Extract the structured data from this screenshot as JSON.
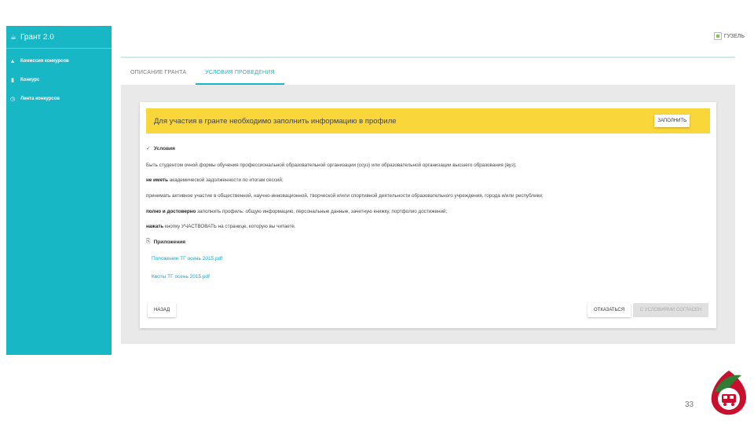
{
  "app": {
    "title": "Грант 2.0"
  },
  "sidebar": {
    "items": [
      {
        "icon": "person-icon",
        "label": "Комиссия конкурсов"
      },
      {
        "icon": "document-icon",
        "label": "Конкурс"
      },
      {
        "icon": "clock-icon",
        "label": "Лента конкурсов"
      }
    ]
  },
  "header": {
    "user_name": "ГУЗЕЛЬ"
  },
  "tabs": [
    {
      "label": "ОПИСАНИЕ ГРАНТА",
      "active": false
    },
    {
      "label": "УСЛОВИЯ ПРОВЕДЕНИЯ",
      "active": true
    }
  ],
  "banner": {
    "text": "Для участия в гранте необходимо заполнить информацию в профиле",
    "button": "ЗАПОЛНИТЬ"
  },
  "conditions": {
    "title": "Условия",
    "items": [
      {
        "bold": "",
        "text": "Быть студентом очной формы обучения профессиональной образовательной организации (ссуз) или образовательной организации высшего образования (вуз);"
      },
      {
        "bold": "не иметь",
        "text": " академической задолженности по итогам сессий;"
      },
      {
        "bold": "",
        "text": "принимать активное участие в общественной, научно-инновационной, творческой и/или спортивной деятельности образовательного учреждения, города и/или республики;"
      },
      {
        "bold": "полно и достоверно",
        "text": " заполнить профиль: общую информацию, персональные данные, зачетную книжку, портфолио достижений;"
      },
      {
        "bold": "нажать",
        "text": " кнопку УЧАСТВОВАТЬ на странице, которую вы читаете."
      }
    ]
  },
  "attachments": {
    "title": "Приложения",
    "files": [
      "Положение ТГ осень 2015.pdf",
      "Квоты ТГ осень 2015.pdf"
    ]
  },
  "actions": {
    "back": "НАЗАД",
    "refuse": "ОТКАЗАТЬСЯ",
    "agree": "С УСЛОВИЯМИ СОГЛАСЕН"
  },
  "slide": {
    "page_number": "33"
  },
  "colors": {
    "accent": "#17b7c6",
    "banner": "#f9d63a",
    "link": "#1ba3c6"
  }
}
